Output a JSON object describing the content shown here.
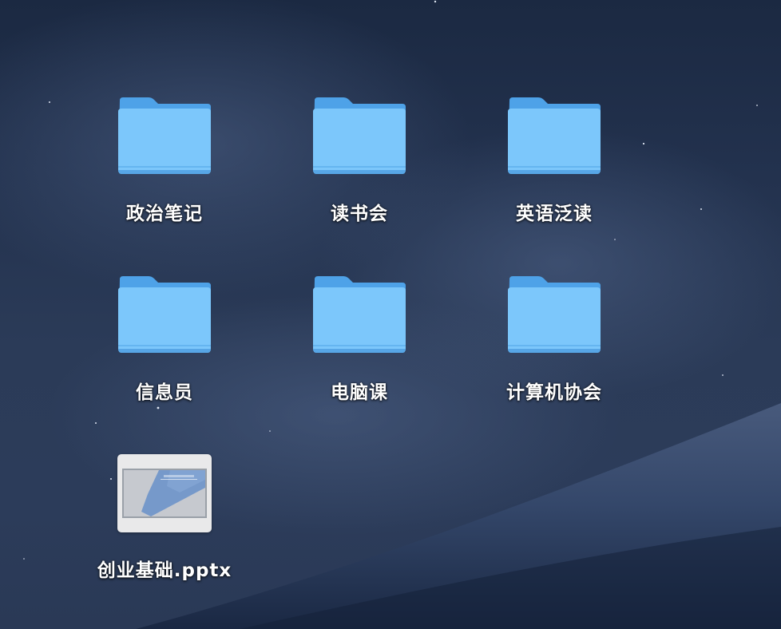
{
  "desktop": {
    "items": [
      {
        "name": "政治笔记",
        "kind": "folder",
        "icon": "folder-icon"
      },
      {
        "name": "读书会",
        "kind": "folder",
        "icon": "folder-icon"
      },
      {
        "name": "英语泛读",
        "kind": "folder",
        "icon": "folder-icon"
      },
      {
        "name": "信息员",
        "kind": "folder",
        "icon": "folder-icon"
      },
      {
        "name": "电脑课",
        "kind": "folder",
        "icon": "folder-icon"
      },
      {
        "name": "计算机协会",
        "kind": "folder",
        "icon": "folder-icon"
      },
      {
        "name": "创业基础.pptx",
        "kind": "file",
        "icon": "pptx-thumbnail-icon"
      }
    ]
  },
  "colors": {
    "folder_front": "#7cc7fb",
    "folder_back": "#4ea2e8",
    "wallpaper_top": "#1b2942",
    "wallpaper_hill": "#2e4063",
    "label_text": "#ffffff"
  }
}
